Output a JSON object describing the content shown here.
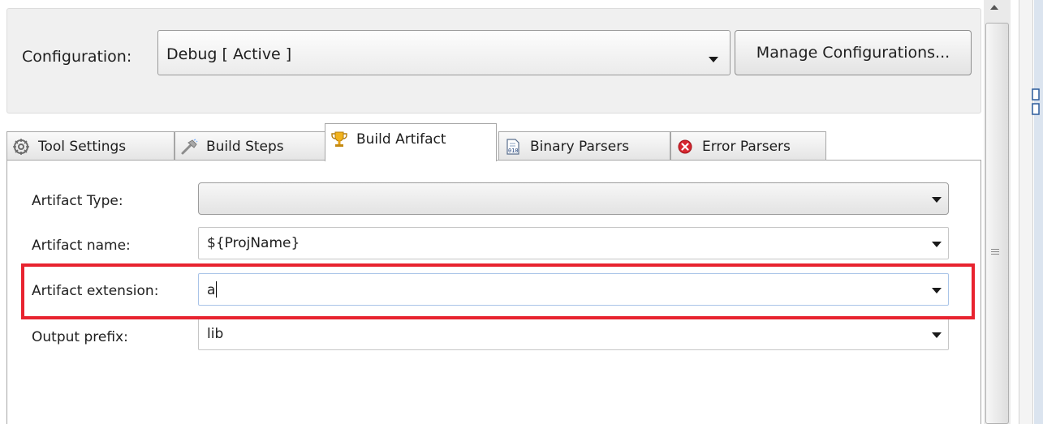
{
  "configuration": {
    "label": "Configuration:",
    "selected": "Debug  [ Active ]",
    "manage_button": "Manage Configurations..."
  },
  "tabs": [
    {
      "label": "Tool Settings",
      "icon": "gear-icon",
      "active": false
    },
    {
      "label": "Build Steps",
      "icon": "hammer-icon",
      "active": false
    },
    {
      "label": "Build Artifact",
      "icon": "trophy-icon",
      "active": true
    },
    {
      "label": "Binary Parsers",
      "icon": "binary-file-icon",
      "active": false
    },
    {
      "label": "Error Parsers",
      "icon": "error-icon",
      "active": false
    }
  ],
  "artifact": {
    "type": {
      "label": "Artifact Type:",
      "value": ""
    },
    "name": {
      "label": "Artifact name:",
      "value": "${ProjName}"
    },
    "extension": {
      "label": "Artifact extension:",
      "value": "a"
    },
    "prefix": {
      "label": "Output prefix:",
      "value": "lib"
    }
  },
  "colors": {
    "highlight": "#e8232f",
    "focus_border": "#a9c4e8",
    "error_icon": "#d7262f",
    "trophy_icon": "#e8a317"
  }
}
